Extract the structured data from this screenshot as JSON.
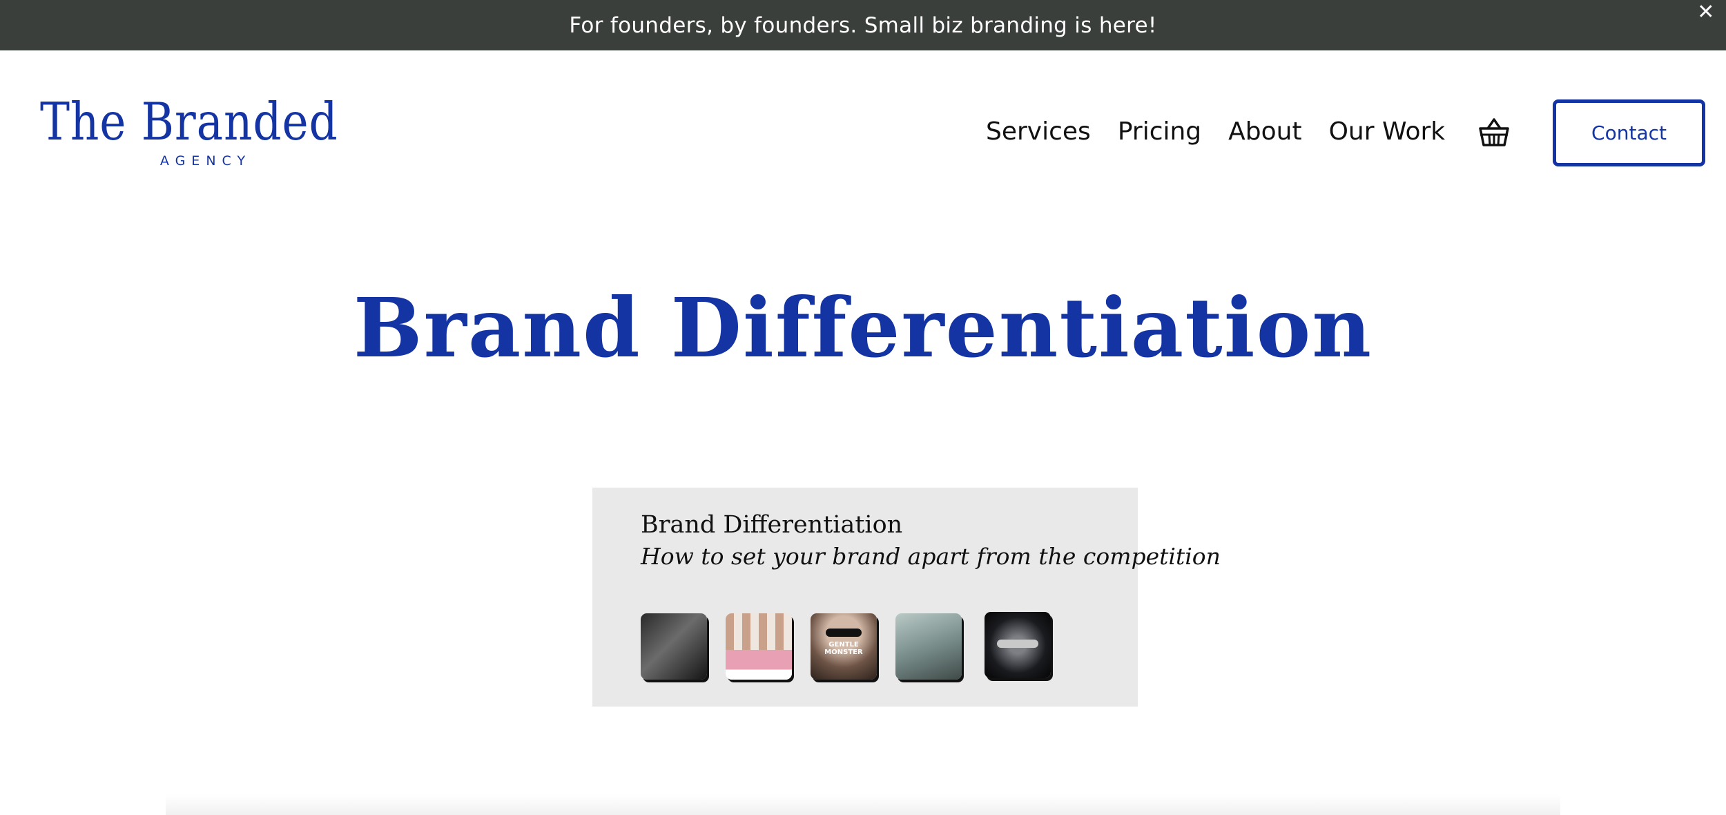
{
  "announcement": {
    "text": "For founders, by founders. Small biz branding is here!",
    "close_icon": "close-icon"
  },
  "brand": {
    "logo_text": "The Branded",
    "logo_subtext": "AGENCY",
    "color": "#1434a4"
  },
  "nav": {
    "items": [
      {
        "label": "Services"
      },
      {
        "label": "Pricing"
      },
      {
        "label": "About"
      },
      {
        "label": "Our Work"
      }
    ],
    "cart_icon": "basket-icon",
    "contact_label": "Contact"
  },
  "hero": {
    "title": "Brand Differentiation"
  },
  "card": {
    "title": "Brand Differentiation",
    "subtitle": "How to set your brand apart from the competition",
    "thumbnails": [
      {
        "label": ""
      },
      {
        "label": ""
      },
      {
        "label": "GENTLE MONSTER"
      },
      {
        "label": ""
      },
      {
        "label": ""
      }
    ]
  },
  "colors": {
    "announcement_bg": "#3b3f3c",
    "accent": "#1434a4",
    "card_bg": "#e9e9e9"
  }
}
